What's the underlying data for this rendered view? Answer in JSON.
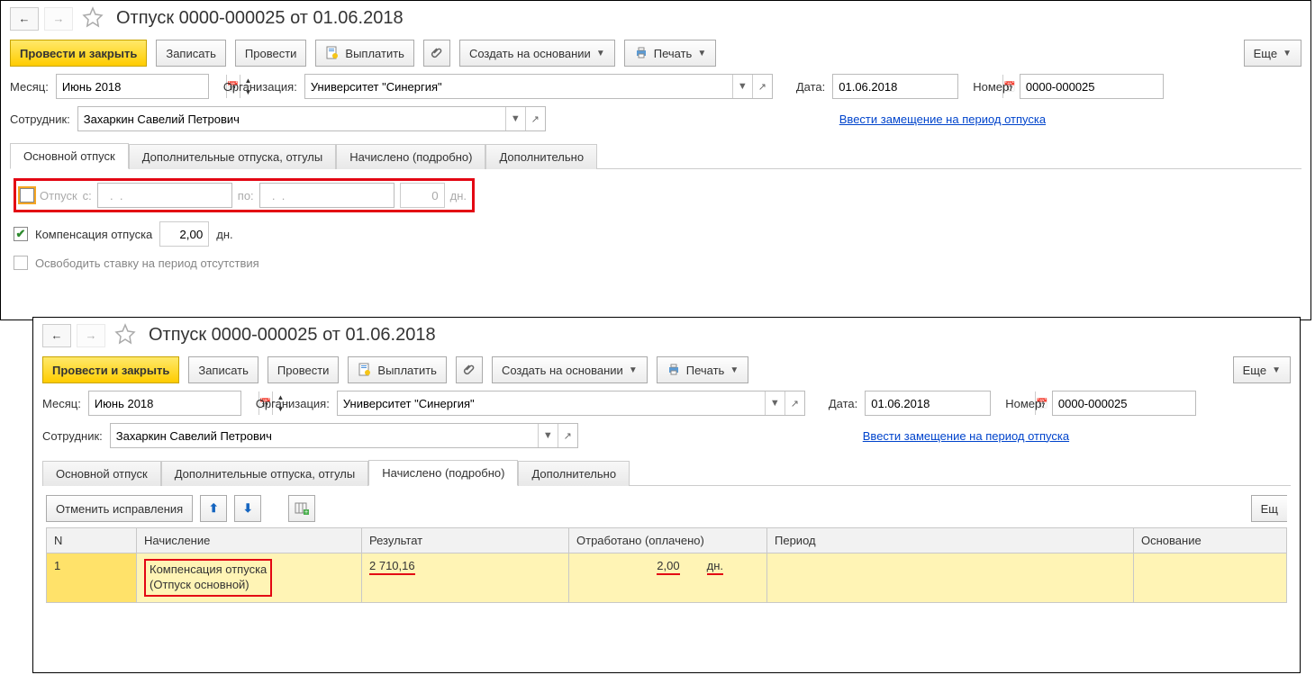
{
  "common": {
    "title": "Отпуск 0000-000025 от 01.06.2018",
    "btn_process_close": "Провести и закрыть",
    "btn_save": "Записать",
    "btn_process": "Провести",
    "btn_pay": "Выплатить",
    "btn_create_based": "Создать на основании",
    "btn_print": "Печать",
    "btn_more": "Еще",
    "lbl_month": "Месяц:",
    "val_month": "Июнь 2018",
    "lbl_org": "Организация:",
    "val_org": "Университет \"Синергия\"",
    "lbl_date": "Дата:",
    "val_date": "01.06.2018",
    "lbl_number": "Номер:",
    "val_number": "0000-000025",
    "lbl_employee": "Сотрудник:",
    "val_employee": "Захаркин Савелий Петрович",
    "link_substitute": "Ввести замещение на период отпуска",
    "tabs": [
      "Основной отпуск",
      "Дополнительные отпуска, отгулы",
      "Начислено (подробно)",
      "Дополнительно"
    ]
  },
  "win1": {
    "active_tab": 0,
    "otpusk_label": "Отпуск",
    "from": "c:",
    "to": "по:",
    "date_placeholder": "  .  .",
    "days_val": "0",
    "days_unit": "дн.",
    "comp_label": "Компенсация отпуска",
    "comp_val": "2,00",
    "comp_unit": "дн.",
    "release_label": "Освободить ставку на период отсутствия"
  },
  "win2": {
    "active_tab": 2,
    "btn_cancel_fix": "Отменить исправления",
    "btn_more2": "Ещ",
    "cols": [
      "N",
      "Начисление",
      "Результат",
      "Отработано (оплачено)",
      "Период",
      "Основание"
    ],
    "row": {
      "n": "1",
      "name_line1": "Компенсация отпуска",
      "name_line2": "(Отпуск основной)",
      "result": "2 710,16",
      "worked_val": "2,00",
      "worked_unit": "дн."
    }
  }
}
